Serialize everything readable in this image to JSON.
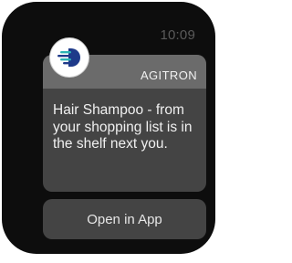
{
  "status": {
    "time": "10:09"
  },
  "notification": {
    "app_name": "AGITRON",
    "app_icon": "agitron-logo-icon",
    "message": "Hair Shampoo - from your shopping list is in the shelf next you.",
    "action_label": "Open in App"
  },
  "colors": {
    "watch_bezel": "#0d0d0d",
    "card_background": "#444444",
    "card_header": "#6b6b6b",
    "logo_blue": "#1e3a8a",
    "logo_accent": "#2bb3b3"
  }
}
